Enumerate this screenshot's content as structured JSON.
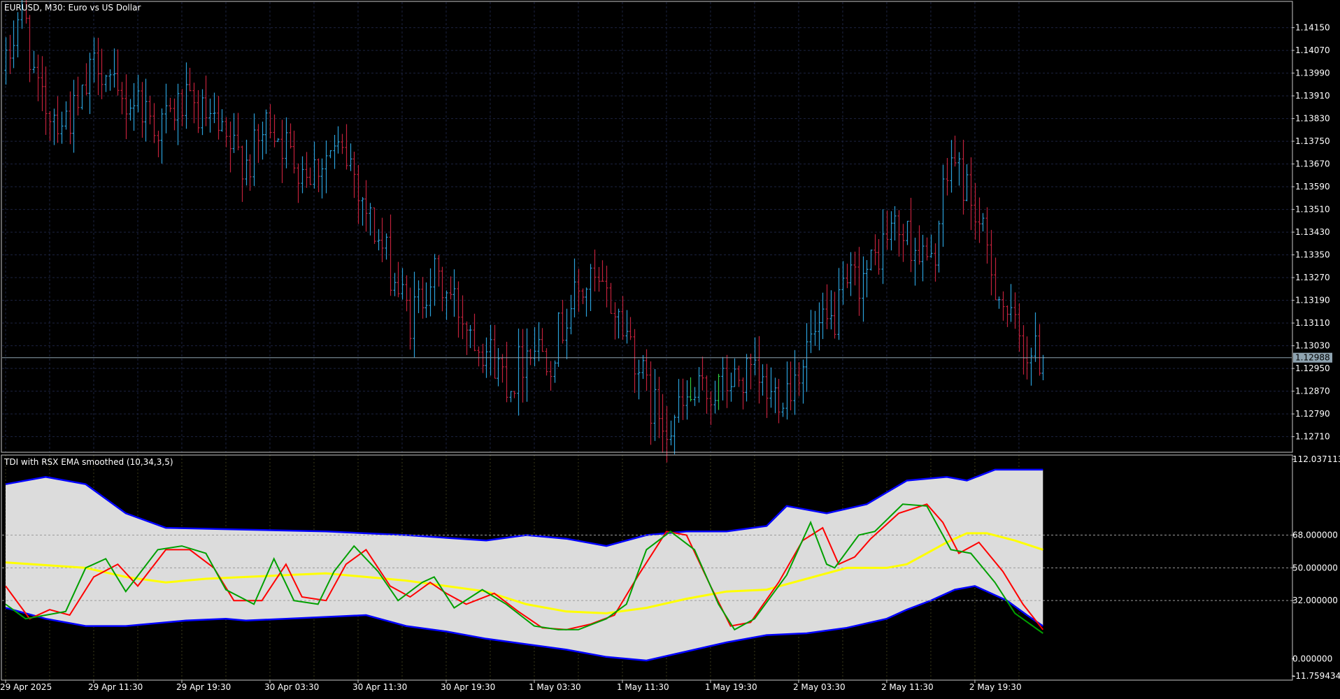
{
  "window": {
    "title": "EURUSD, M30:  Euro vs US Dollar",
    "indicator_title": "TDI with RSX EMA smoothed (10,34,3,5)"
  },
  "colors": {
    "background": "#000000",
    "grid": "#1c2340",
    "frame": "#c8c8c8",
    "bull_candle": "#2a9fd8",
    "bear_candle": "#c0213a",
    "neutral_candle": "#2ecc40",
    "current_price_line": "#8ea3b0",
    "band_fill": "#dcdcdc",
    "band_line": "#0000ff",
    "price_line": "#00a000",
    "signal_line": "#ff0000",
    "market_base_line": "#ffff00",
    "level_line": "#9a9a9a"
  },
  "chart_data": [
    {
      "type": "candlestick",
      "symbol": "EURUSD",
      "timeframe": "M30",
      "title": "EURUSD, M30:  Euro vs US Dollar",
      "y_ticks": [
        "1.14150",
        "1.14070",
        "1.13990",
        "1.13910",
        "1.13830",
        "1.13750",
        "1.13670",
        "1.13590",
        "1.13510",
        "1.13430",
        "1.13350",
        "1.13270",
        "1.13190",
        "1.13110",
        "1.13030",
        "1.12950",
        "1.12870",
        "1.12790",
        "1.12710"
      ],
      "ylim": [
        1.12655,
        1.1424
      ],
      "current_price": 1.12988,
      "current_price_label": "1.12988",
      "grid": true,
      "anchors": [
        [
          0,
          1.14
        ],
        [
          4,
          1.1425
        ],
        [
          8,
          1.139
        ],
        [
          14,
          1.1383
        ],
        [
          18,
          1.1385
        ],
        [
          23,
          1.1405
        ],
        [
          28,
          1.1388
        ],
        [
          33,
          1.139
        ],
        [
          38,
          1.138
        ],
        [
          44,
          1.1388
        ],
        [
          50,
          1.1383
        ],
        [
          55,
          1.1373
        ],
        [
          61,
          1.1368
        ],
        [
          66,
          1.1383
        ],
        [
          71,
          1.137
        ],
        [
          76,
          1.1365
        ],
        [
          81,
          1.1371
        ],
        [
          86,
          1.1368
        ],
        [
          91,
          1.1347
        ],
        [
          96,
          1.133
        ],
        [
          101,
          1.1312
        ],
        [
          106,
          1.1328
        ],
        [
          111,
          1.132
        ],
        [
          116,
          1.131
        ],
        [
          121,
          1.13
        ],
        [
          126,
          1.129
        ],
        [
          131,
          1.1305
        ],
        [
          136,
          1.13
        ],
        [
          141,
          1.1318
        ],
        [
          146,
          1.1325
        ],
        [
          151,
          1.1318
        ],
        [
          156,
          1.1305
        ],
        [
          161,
          1.1282
        ],
        [
          166,
          1.1276
        ],
        [
          171,
          1.1284
        ],
        [
          176,
          1.1287
        ],
        [
          181,
          1.129
        ],
        [
          186,
          1.1292
        ],
        [
          191,
          1.1285
        ],
        [
          196,
          1.129
        ],
        [
          201,
          1.1305
        ],
        [
          206,
          1.131
        ],
        [
          211,
          1.1325
        ],
        [
          216,
          1.133
        ],
        [
          221,
          1.1345
        ],
        [
          226,
          1.134
        ],
        [
          231,
          1.133
        ],
        [
          236,
          1.137
        ],
        [
          241,
          1.1355
        ],
        [
          246,
          1.133
        ],
        [
          251,
          1.131
        ],
        [
          256,
          1.13
        ],
        [
          259,
          1.12988
        ]
      ],
      "x_tick_labels": [
        "29 Apr 2025",
        "29 Apr 11:30",
        "29 Apr 19:30",
        "30 Apr 03:30",
        "30 Apr 11:30",
        "30 Apr 19:30",
        "1 May 03:30",
        "1 May 11:30",
        "1 May 19:30",
        "2 May 03:30",
        "2 May 11:30",
        "2 May 19:30"
      ],
      "x_tick_bars": [
        0,
        22,
        44,
        66,
        88,
        110,
        132,
        154,
        176,
        198,
        220,
        242
      ]
    },
    {
      "type": "line",
      "title": "TDI with RSX EMA smoothed (10,34,3,5)",
      "ylim": [
        -11.759434,
        112.037113
      ],
      "y_ticks": [
        "112.037113",
        "68.000000",
        "50.000000",
        "32.000000",
        "0.000000",
        "-11.759434"
      ],
      "levels": [
        68,
        50,
        32
      ],
      "series": [
        {
          "key": "upper_band",
          "points": [
            [
              0,
              96
            ],
            [
              10,
              100
            ],
            [
              20,
              96
            ],
            [
              30,
              80
            ],
            [
              40,
              72
            ],
            [
              60,
              71
            ],
            [
              80,
              70
            ],
            [
              100,
              68
            ],
            [
              120,
              65
            ],
            [
              130,
              68
            ],
            [
              140,
              66
            ],
            [
              150,
              62
            ],
            [
              160,
              68
            ],
            [
              170,
              70
            ],
            [
              180,
              70
            ],
            [
              190,
              73
            ],
            [
              195,
              84
            ],
            [
              205,
              80
            ],
            [
              215,
              85
            ],
            [
              225,
              98
            ],
            [
              235,
              100
            ],
            [
              240,
              98
            ],
            [
              247,
              104
            ],
            [
              259,
              104
            ]
          ]
        },
        {
          "key": "lower_band",
          "points": [
            [
              0,
              28
            ],
            [
              10,
              22
            ],
            [
              20,
              18
            ],
            [
              30,
              18
            ],
            [
              45,
              21
            ],
            [
              55,
              22
            ],
            [
              60,
              21
            ],
            [
              70,
              22
            ],
            [
              80,
              23
            ],
            [
              90,
              24
            ],
            [
              100,
              18
            ],
            [
              110,
              15
            ],
            [
              120,
              11
            ],
            [
              130,
              8
            ],
            [
              140,
              5
            ],
            [
              150,
              1
            ],
            [
              160,
              -1
            ],
            [
              170,
              4
            ],
            [
              180,
              9
            ],
            [
              190,
              13
            ],
            [
              200,
              14
            ],
            [
              210,
              17
            ],
            [
              220,
              22
            ],
            [
              225,
              27
            ],
            [
              231,
              32
            ],
            [
              237,
              38
            ],
            [
              242,
              40
            ],
            [
              250,
              32
            ],
            [
              255,
              24
            ],
            [
              259,
              18
            ]
          ]
        },
        {
          "key": "market_base",
          "points": [
            [
              0,
              53
            ],
            [
              20,
              50
            ],
            [
              30,
              45
            ],
            [
              40,
              42
            ],
            [
              50,
              44
            ],
            [
              60,
              45
            ],
            [
              70,
              46
            ],
            [
              80,
              47
            ],
            [
              90,
              45
            ],
            [
              100,
              43
            ],
            [
              110,
              40
            ],
            [
              120,
              37
            ],
            [
              130,
              30
            ],
            [
              140,
              26
            ],
            [
              150,
              25
            ],
            [
              160,
              28
            ],
            [
              170,
              33
            ],
            [
              180,
              37
            ],
            [
              190,
              38
            ],
            [
              200,
              44
            ],
            [
              210,
              50
            ],
            [
              220,
              50
            ],
            [
              225,
              52
            ],
            [
              230,
              58
            ],
            [
              235,
              64
            ],
            [
              240,
              69
            ],
            [
              245,
              69
            ],
            [
              252,
              65
            ],
            [
              259,
              60
            ]
          ]
        },
        {
          "key": "price_line",
          "points": [
            [
              0,
              30
            ],
            [
              5,
              22
            ],
            [
              10,
              24
            ],
            [
              15,
              26
            ],
            [
              20,
              50
            ],
            [
              25,
              55
            ],
            [
              30,
              37
            ],
            [
              38,
              60
            ],
            [
              44,
              62
            ],
            [
              50,
              58
            ],
            [
              55,
              38
            ],
            [
              62,
              30
            ],
            [
              67,
              55
            ],
            [
              72,
              32
            ],
            [
              78,
              30
            ],
            [
              82,
              48
            ],
            [
              87,
              62
            ],
            [
              93,
              48
            ],
            [
              98,
              32
            ],
            [
              104,
              42
            ],
            [
              107,
              45
            ],
            [
              112,
              28
            ],
            [
              119,
              38
            ],
            [
              125,
              30
            ],
            [
              132,
              18
            ],
            [
              138,
              16
            ],
            [
              143,
              16
            ],
            [
              150,
              22
            ],
            [
              155,
              30
            ],
            [
              160,
              60
            ],
            [
              166,
              70
            ],
            [
              172,
              60
            ],
            [
              178,
              30
            ],
            [
              182,
              16
            ],
            [
              187,
              22
            ],
            [
              195,
              46
            ],
            [
              201,
              75
            ],
            [
              205,
              52
            ],
            [
              207,
              50
            ],
            [
              213,
              68
            ],
            [
              217,
              70
            ],
            [
              224,
              85
            ],
            [
              230,
              84
            ],
            [
              236,
              60
            ],
            [
              241,
              58
            ],
            [
              247,
              42
            ],
            [
              252,
              25
            ],
            [
              259,
              14
            ]
          ]
        },
        {
          "key": "signal_line",
          "points": [
            [
              0,
              40
            ],
            [
              6,
              22
            ],
            [
              11,
              27
            ],
            [
              16,
              24
            ],
            [
              22,
              45
            ],
            [
              28,
              52
            ],
            [
              33,
              40
            ],
            [
              40,
              60
            ],
            [
              46,
              60
            ],
            [
              52,
              50
            ],
            [
              57,
              32
            ],
            [
              64,
              32
            ],
            [
              70,
              52
            ],
            [
              74,
              34
            ],
            [
              80,
              32
            ],
            [
              85,
              52
            ],
            [
              90,
              60
            ],
            [
              96,
              40
            ],
            [
              101,
              34
            ],
            [
              106,
              42
            ],
            [
              110,
              36
            ],
            [
              115,
              30
            ],
            [
              122,
              36
            ],
            [
              128,
              26
            ],
            [
              134,
              17
            ],
            [
              140,
              16
            ],
            [
              146,
              19
            ],
            [
              152,
              24
            ],
            [
              158,
              46
            ],
            [
              165,
              70
            ],
            [
              170,
              68
            ],
            [
              176,
              40
            ],
            [
              181,
              18
            ],
            [
              186,
              20
            ],
            [
              193,
              42
            ],
            [
              199,
              65
            ],
            [
              204,
              72
            ],
            [
              208,
              52
            ],
            [
              212,
              56
            ],
            [
              216,
              66
            ],
            [
              223,
              80
            ],
            [
              230,
              85
            ],
            [
              234,
              75
            ],
            [
              238,
              58
            ],
            [
              243,
              64
            ],
            [
              249,
              48
            ],
            [
              254,
              30
            ],
            [
              259,
              16
            ]
          ]
        }
      ]
    }
  ]
}
